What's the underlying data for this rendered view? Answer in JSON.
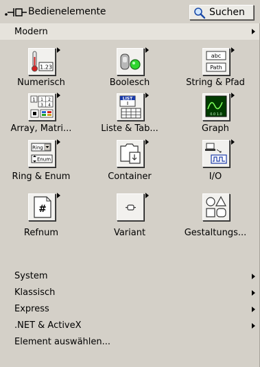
{
  "titlebar": {
    "title": "Bedienelemente",
    "search_label": "Suchen"
  },
  "category": {
    "label": "Modern"
  },
  "items": [
    {
      "label": "Numerisch",
      "icon": "numeric-icon"
    },
    {
      "label": "Boolesch",
      "icon": "boolean-icon"
    },
    {
      "label": "String & Pfad",
      "icon": "string-path-icon"
    },
    {
      "label": "Array, Matri...",
      "icon": "array-matrix-icon"
    },
    {
      "label": "Liste & Tab...",
      "icon": "list-table-icon"
    },
    {
      "label": "Graph",
      "icon": "graph-icon"
    },
    {
      "label": "Ring & Enum",
      "icon": "ring-enum-icon"
    },
    {
      "label": "Container",
      "icon": "container-icon"
    },
    {
      "label": "I/O",
      "icon": "io-icon"
    },
    {
      "label": "Refnum",
      "icon": "refnum-icon"
    },
    {
      "label": "Variant",
      "icon": "variant-icon"
    },
    {
      "label": "Gestaltungs...",
      "icon": "decorations-icon"
    }
  ],
  "icon_text": {
    "numeric_value": "1.23",
    "string_top": "abc",
    "string_bottom": "Path",
    "array_cells": [
      "1",
      "1",
      "2",
      "3",
      "4"
    ],
    "list_header": "LIST",
    "ring_top": "Ring",
    "ring_bottom": "Enum",
    "graph_axis": "0.0 1.0",
    "refnum_symbol": "#"
  },
  "menu": [
    {
      "label": "System",
      "has_submenu": true
    },
    {
      "label": "Klassisch",
      "has_submenu": true
    },
    {
      "label": "Express",
      "has_submenu": true
    },
    {
      "label": ".NET & ActiveX",
      "has_submenu": true
    },
    {
      "label": "Element auswählen...",
      "has_submenu": false
    }
  ],
  "colors": {
    "panel_bg": "#d4d0c8",
    "subhead_bg": "#e6e3dc",
    "icon_bg": "#f2f1ee",
    "bool_led": "#2fd62f",
    "graph_bg": "#003a00",
    "graph_line": "#7cff5a",
    "thermo_red": "#d42020"
  }
}
